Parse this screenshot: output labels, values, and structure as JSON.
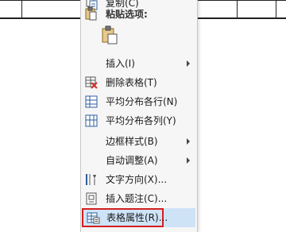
{
  "menu": {
    "copy_label": "复制(C)",
    "paste_options_label": "粘贴选项:",
    "insert_label": "插入(I)",
    "delete_table_label": "删除表格(T)",
    "distribute_rows_label": "平均分布各行(N)",
    "distribute_cols_label": "平均分布各列(Y)",
    "border_styles_label": "边框样式(B)",
    "autofit_label": "自动调整(A)",
    "text_direction_label": "文字方向(X)...",
    "insert_caption_label": "插入题注(C)...",
    "table_properties_label": "表格属性(R)..."
  },
  "colors": {
    "highlight_border": "#d32020",
    "hover_fill": "#cfe3f7",
    "delete_icon_red": "#d2322d",
    "icon_blue": "#2f5f9e"
  },
  "icons": {
    "copy": "copy-icon",
    "paste_header": "clipboard-icon",
    "paste_keep": "paste-keep-source-icon",
    "delete": "delete-table-icon",
    "rows": "distribute-rows-icon",
    "cols": "distribute-columns-icon",
    "text_dir": "text-direction-icon",
    "caption": "insert-caption-icon",
    "props": "table-properties-icon"
  }
}
